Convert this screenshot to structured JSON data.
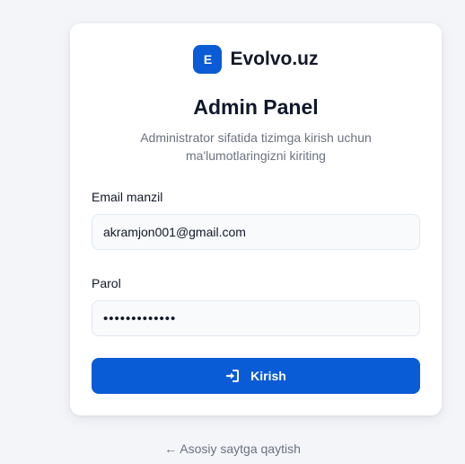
{
  "brand": {
    "logo_letter": "E",
    "name": "Evolvo.uz",
    "logo_color": "#0a5bd6"
  },
  "title": "Admin Panel",
  "subtitle": "Administrator sifatida tizimga kirish uchun ma'lumotlaringizni kiriting",
  "form": {
    "email_label": "Email manzil",
    "email_value": "akramjon001@gmail.com",
    "password_label": "Parol",
    "password_value": "•••••••••••••",
    "submit_label": "Kirish",
    "submit_icon": "sign-in-icon",
    "accent_color": "#0a5bd6"
  },
  "back_link": "← Asosiy saytga qaytish"
}
